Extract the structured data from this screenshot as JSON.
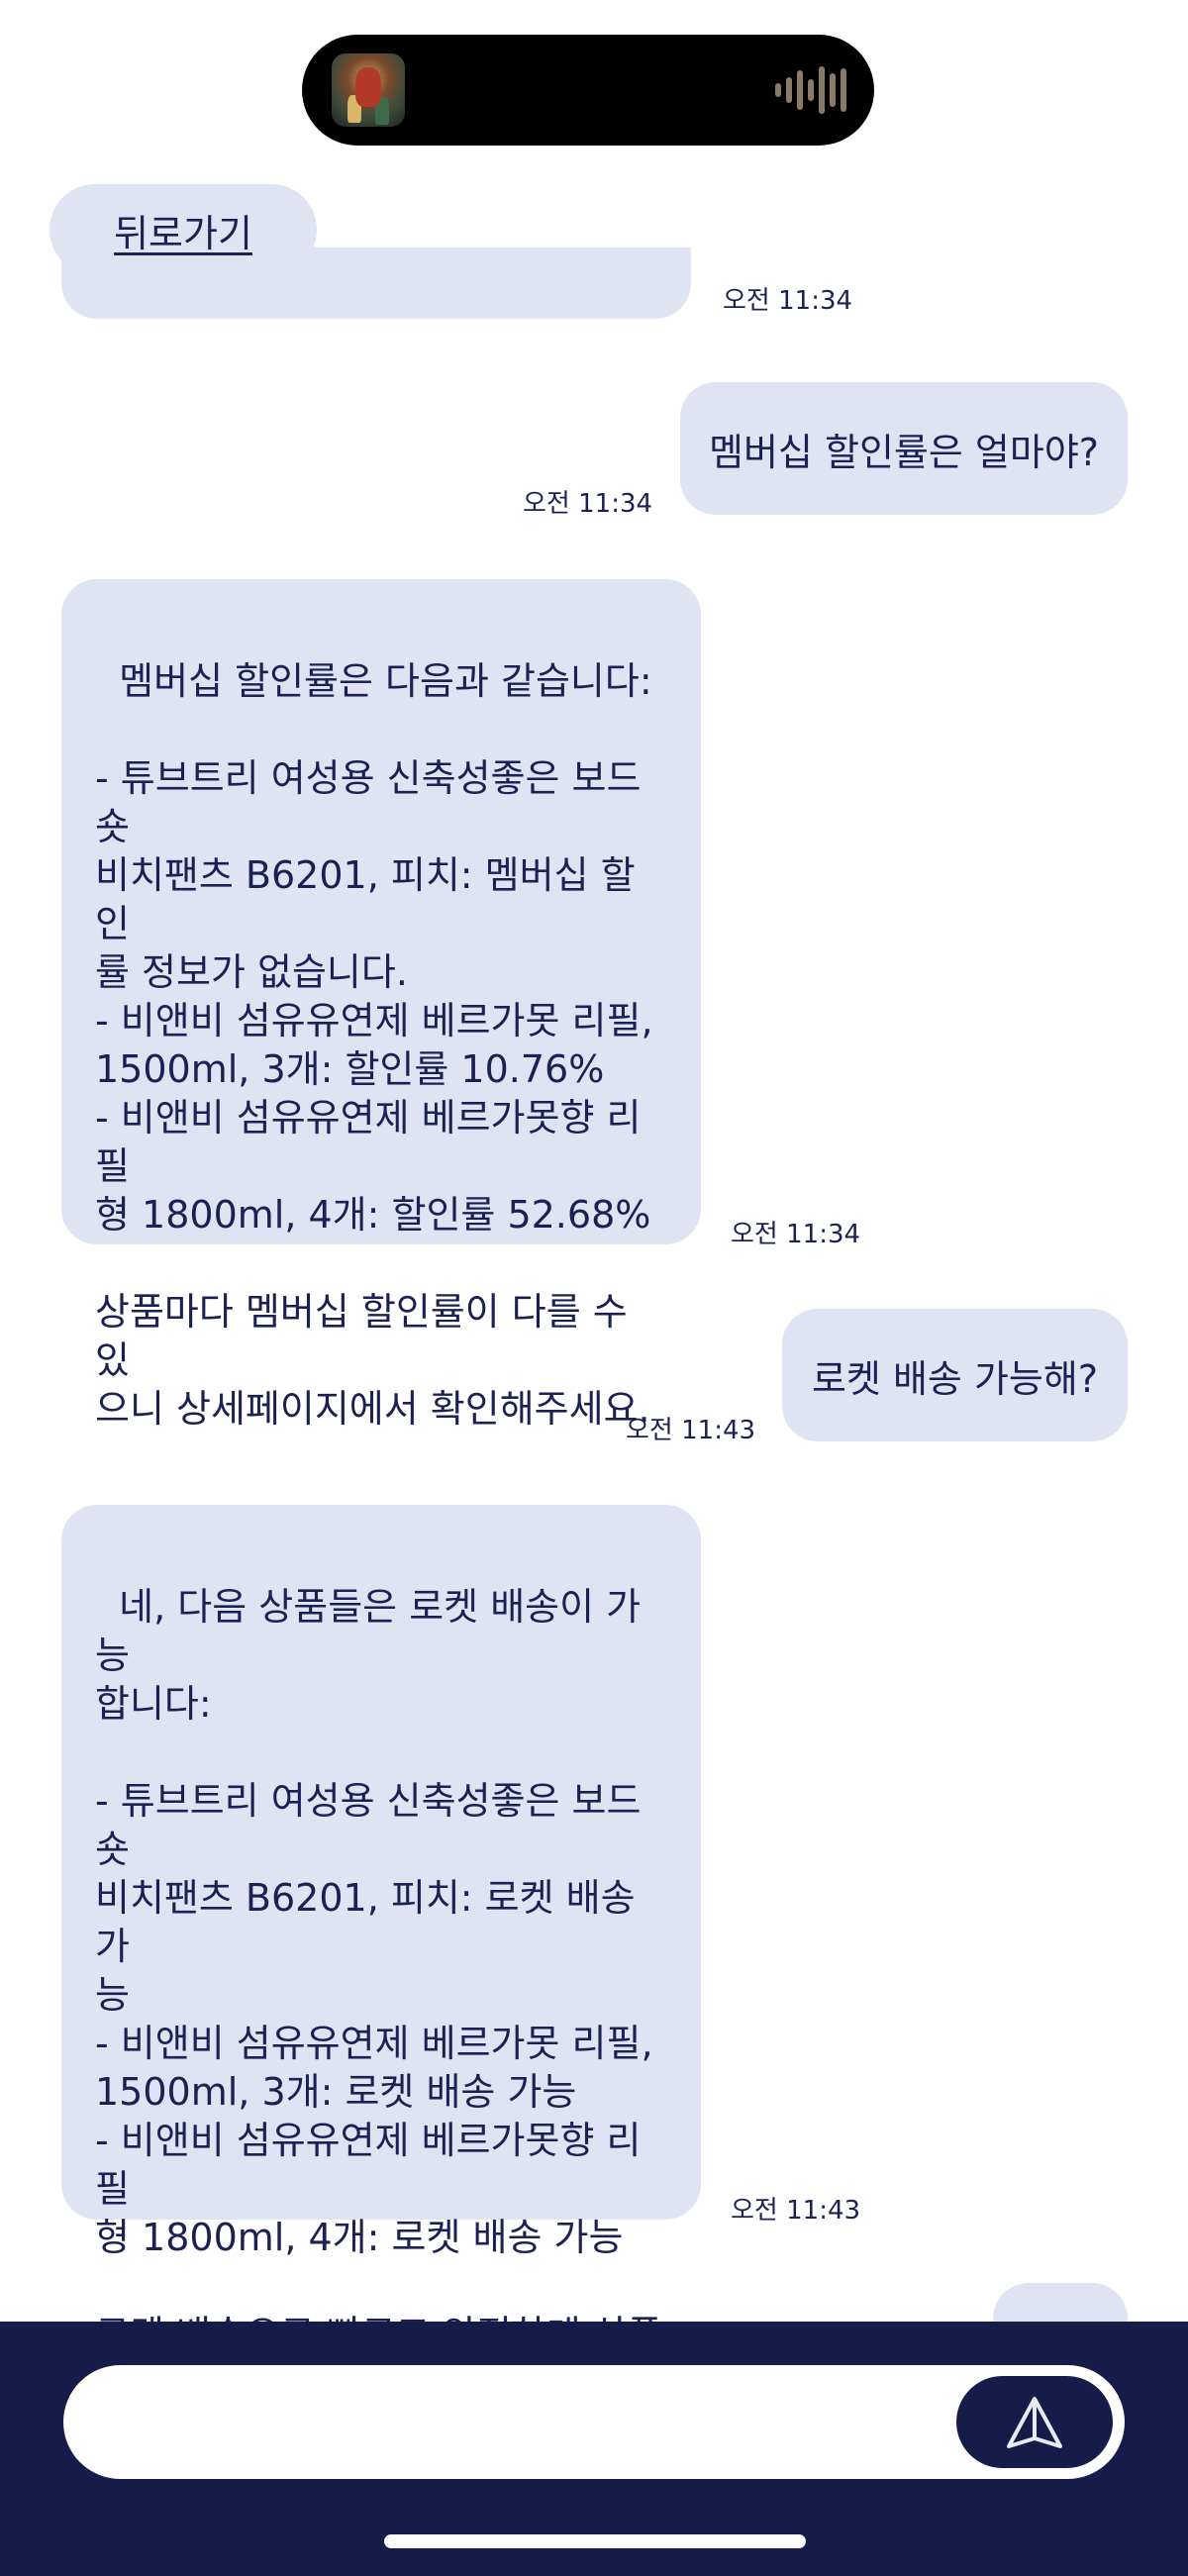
{
  "header": {
    "back_label": "뒤로가기"
  },
  "now_playing": {
    "art_icon": "album-art-thumbnail",
    "wave_icon": "audio-waveform-icon"
  },
  "chat": {
    "partial_top_time": "오전 11:34",
    "messages": [
      {
        "role": "user",
        "text": "멤버십 할인률은 얼마야?",
        "time": "오전 11:34"
      },
      {
        "role": "bot",
        "text": "멤버십 할인률은 다음과 같습니다:\n\n- 튜브트리 여성용 신축성좋은 보드숏\n비치팬츠 B6201, 피치: 멤버십 할인\n률 정보가 없습니다.\n- 비앤비 섬유유연제 베르가못 리필,\n1500ml, 3개: 할인률 10.76%\n- 비앤비 섬유유연제 베르가못향 리필\n형 1800ml, 4개: 할인률 52.68%\n\n상품마다 멤버십 할인률이 다를 수 있\n으니 상세페이지에서 확인해주세요.",
        "time": "오전 11:34"
      },
      {
        "role": "user",
        "text": "로켓 배송 가능해?",
        "time": "오전 11:43"
      },
      {
        "role": "bot",
        "text": "네, 다음 상품들은 로켓 배송이 가능\n합니다:\n\n- 튜브트리 여성용 신축성좋은 보드숏\n비치팬츠 B6201, 피치: 로켓 배송 가\n능\n- 비앤비 섬유유연제 베르가못 리필,\n1500ml, 3개: 로켓 배송 가능\n- 비앤비 섬유유연제 베르가못향 리필\n형 1800ml, 4개: 로켓 배송 가능\n\n로켓 배송으로 빠르고 안전하게 상품\n을 받을 수 있습니다.",
        "time": "오전 11:43"
      }
    ]
  },
  "composer": {
    "input_value": "",
    "input_placeholder": "",
    "send_icon": "send-triangle-icon"
  },
  "colors": {
    "bubble": "#dfe3f2",
    "text": "#1b2152",
    "bar": "#151c4a"
  }
}
